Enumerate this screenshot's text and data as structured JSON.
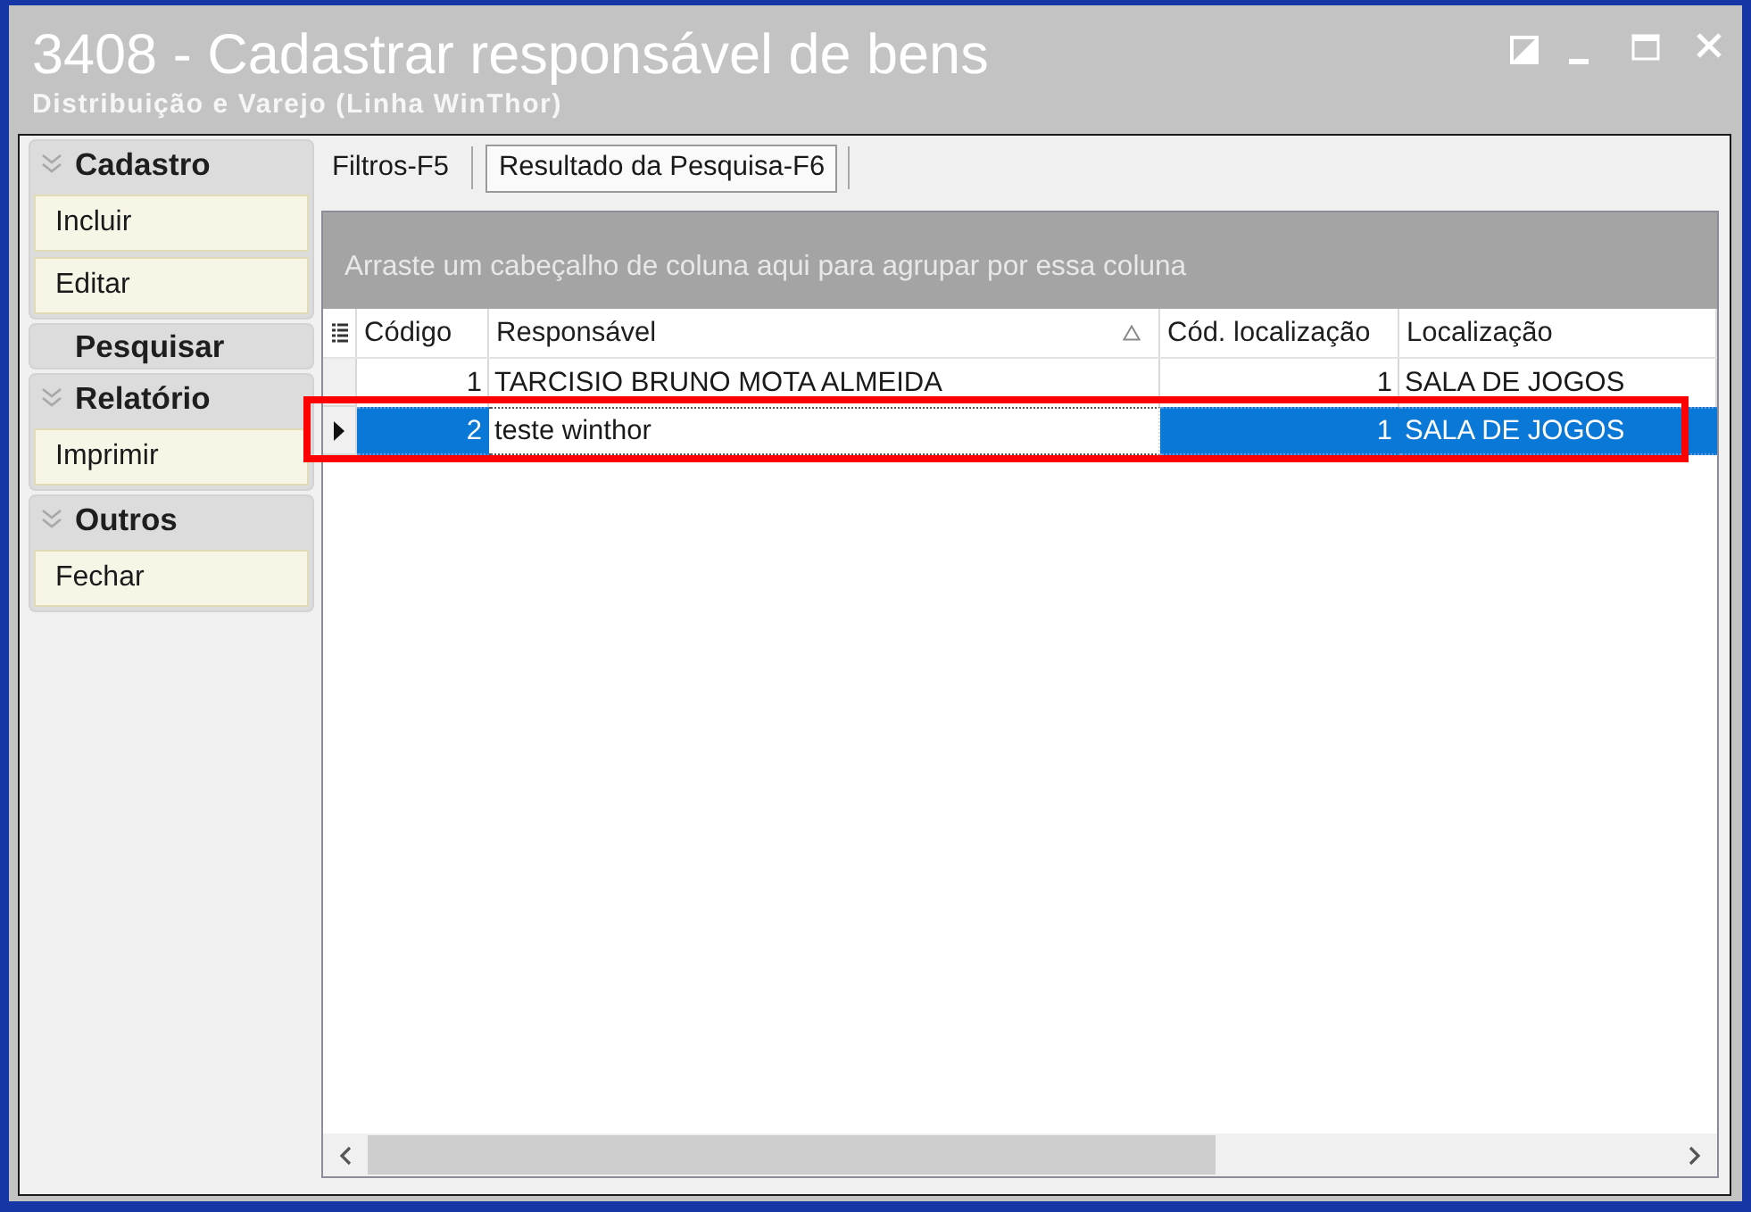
{
  "window": {
    "title": "3408 - Cadastrar responsável de bens",
    "subtitle": "Distribuição e Varejo (Linha WinThor)"
  },
  "sidebar": {
    "groups": [
      {
        "title": "Cadastro",
        "kind": "group",
        "expanded": true,
        "items": [
          "Incluir",
          "Editar"
        ]
      },
      {
        "title": "Pesquisar",
        "kind": "link"
      },
      {
        "title": "Relatório",
        "kind": "group",
        "expanded": true,
        "items": [
          "Imprimir"
        ]
      },
      {
        "title": "Outros",
        "kind": "group",
        "expanded": true,
        "items": [
          "Fechar"
        ]
      }
    ]
  },
  "tabs": [
    {
      "label": "Filtros-F5",
      "selected": false
    },
    {
      "label": "Resultado da Pesquisa-F6",
      "selected": true
    }
  ],
  "grid": {
    "group_hint": "Arraste um cabeçalho de coluna aqui para agrupar por essa coluna",
    "columns": [
      {
        "label": "Código",
        "kind": "number",
        "sorted": false
      },
      {
        "label": "Responsável",
        "kind": "text",
        "sorted": true
      },
      {
        "label": "Cód. localização",
        "kind": "number",
        "sorted": false
      },
      {
        "label": "Localização",
        "kind": "text",
        "sorted": false
      }
    ],
    "rows": [
      {
        "selected": false,
        "highlighted": false,
        "cells": [
          {
            "text": "1",
            "focused": false
          },
          {
            "text": "TARCISIO BRUNO MOTA ALMEIDA",
            "focused": false
          },
          {
            "text": "1",
            "focused": false
          },
          {
            "text": "SALA DE JOGOS",
            "focused": false
          }
        ]
      },
      {
        "selected": true,
        "highlighted": true,
        "cells": [
          {
            "text": "2",
            "focused": false
          },
          {
            "text": "teste winthor",
            "focused": true
          },
          {
            "text": "1",
            "focused": false
          },
          {
            "text": "SALA DE JOGOS",
            "focused": false
          }
        ]
      }
    ]
  }
}
